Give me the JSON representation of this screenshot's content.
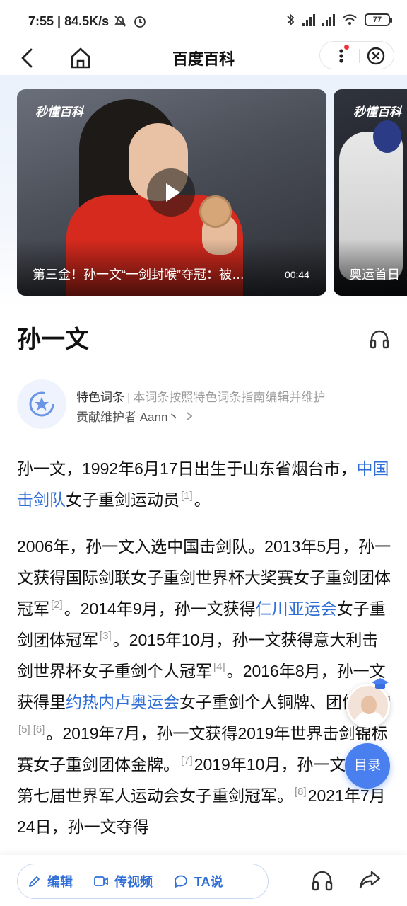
{
  "status_bar": {
    "time": "7:55",
    "speed": "84.5K/s",
    "battery": "77",
    "icons": [
      "silent-alarm-icon",
      "alarm-icon",
      "bluetooth-icon",
      "signal-icon",
      "signal-icon",
      "wifi-icon",
      "battery-icon"
    ]
  },
  "nav": {
    "title": "百度百科",
    "icons": [
      "back-icon",
      "home-icon",
      "more-icon",
      "close-icon"
    ],
    "notification_color": "#f0303a"
  },
  "videos": [
    {
      "watermark": "秒懂百科",
      "caption": "第三金！孙一文“一剑封喉”夺冠：被…",
      "duration": "00:44"
    },
    {
      "watermark": "秒懂百科",
      "caption": "奥运首日"
    }
  ],
  "entry": {
    "title": "孙一文"
  },
  "feature": {
    "tag": "特色词条",
    "separator": "|",
    "desc": "本词条按照特色词条指南编辑并维护",
    "contributor": "贡献维护者 Aann丶"
  },
  "article": {
    "p1": {
      "t1": "孙一文，1992年6月17日出生于山东省烟台市，",
      "link1": "中国击剑队",
      "t2": "女子重剑运动员",
      "ref1": "[1]",
      "t3": "。"
    },
    "p2": {
      "t1": "2006年，孙一文入选中国击剑队。2013年5月，孙一文获得国际剑联女子重剑世界杯大奖赛女子重剑团体冠军",
      "ref2": "[2]",
      "t2": "。2014年9月，孙一文获得",
      "link2": "仁川亚运会",
      "t3": "女子重剑团体冠军",
      "ref3": "[3]",
      "t4": "。2015年10月，孙一文获得意大利击剑世界杯女子重剑个人冠军",
      "ref4": "[4]",
      "t5": "。2016年8月，孙一文获得里",
      "link3": "约热内卢奥运会",
      "t6": "女子重剑个人铜牌、团体银牌",
      "ref5": "[5]",
      "ref6": "[6]",
      "t7": "。2019年7月，孙一文获得2019年世界击剑锦标赛女子重剑团体金牌。",
      "ref7": "[7]",
      "t8": "2019年10月，孙一文获得第七届世界军人运动会女子重剑冠军。",
      "ref8": "[8]",
      "t9": "2021年7月24日，孙一文夺得"
    }
  },
  "floating": {
    "toc_label": "目录"
  },
  "bottom_bar": {
    "edit_label": "编辑",
    "video_label": "传视频",
    "ta_label": "TA说",
    "icons": [
      "edit-icon",
      "video-icon",
      "chat-icon",
      "headphones-icon",
      "share-icon"
    ]
  },
  "colors": {
    "accent": "#2f6ed6",
    "toc_button": "#4a7ff0",
    "link": "#2f6ed6"
  }
}
